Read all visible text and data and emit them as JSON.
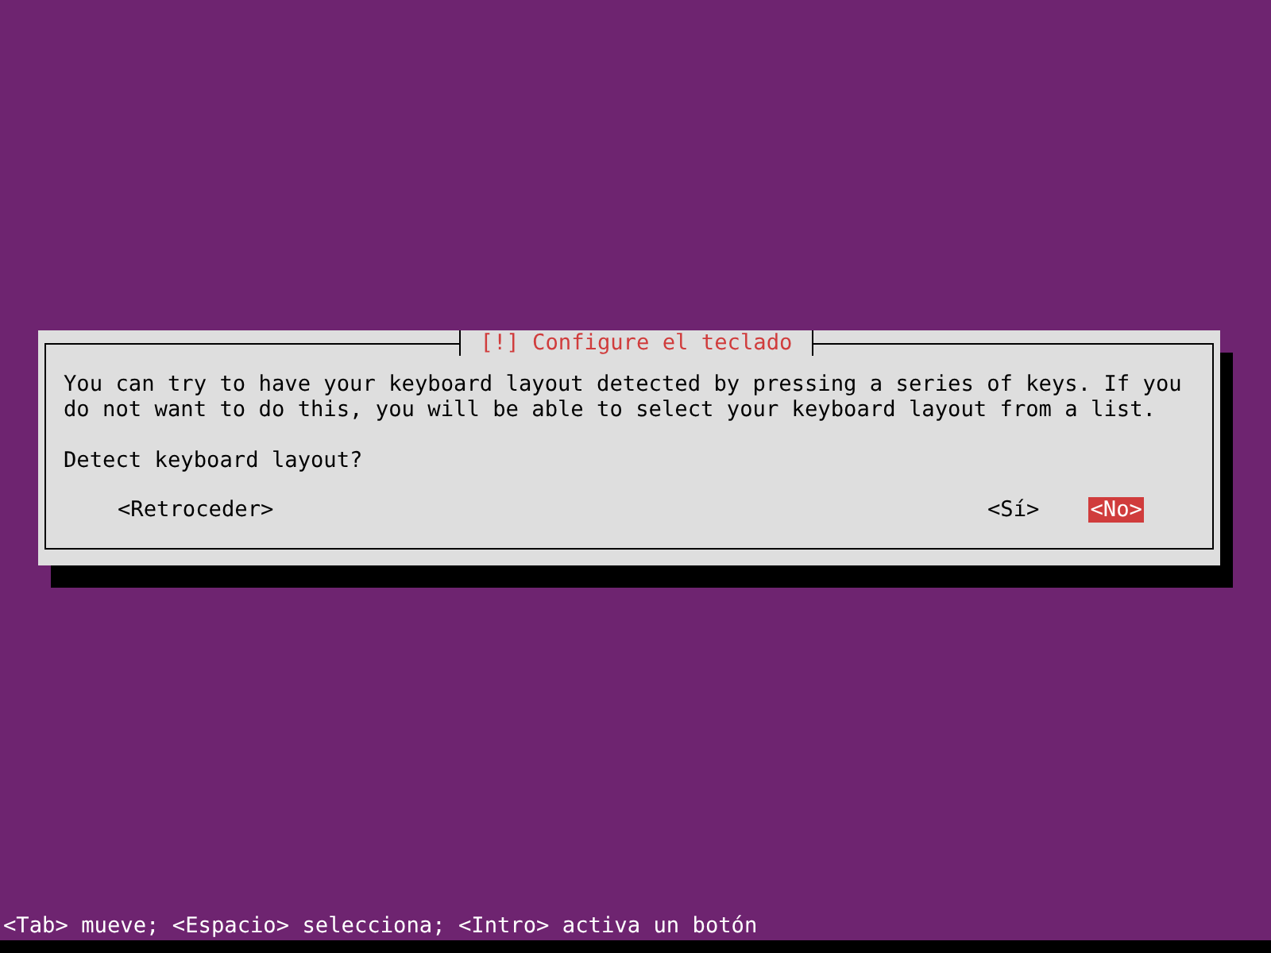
{
  "dialog": {
    "title": "[!] Configure el teclado",
    "message": "You can try to have your keyboard layout detected by pressing a series of keys. If you do not want to do this, you will be able to select your keyboard layout from a list.",
    "question": "Detect keyboard layout?",
    "buttons": [
      {
        "label": "<Retroceder>",
        "kind": "back",
        "selected": false
      },
      {
        "label": "<Sí>",
        "kind": "answer",
        "selected": false
      },
      {
        "label": "<No>",
        "kind": "answer",
        "selected": true
      }
    ]
  },
  "status_bar": "<Tab> mueve; <Espacio> selecciona; <Intro> activa un botón"
}
